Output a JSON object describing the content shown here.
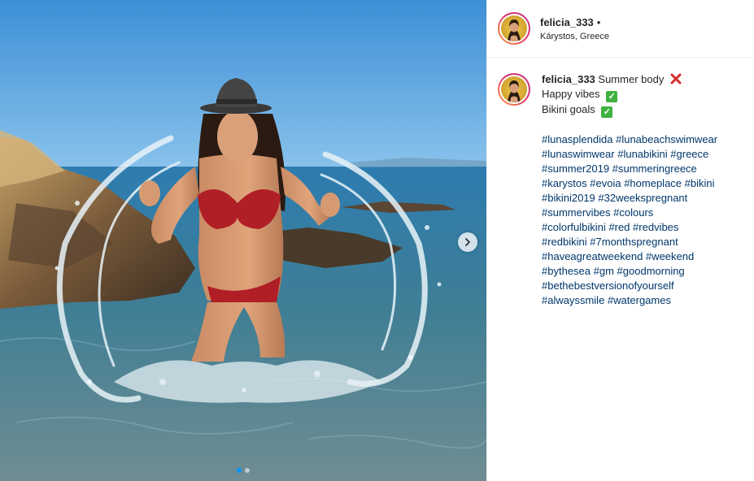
{
  "post": {
    "username": "felicia_333",
    "bullet": "•",
    "location": "Kárystos, Greece",
    "photo_description": "",
    "carousel": {
      "total": 2,
      "active": 1
    },
    "caption": {
      "username": "felicia_333",
      "line1": "Summer body",
      "line1_emoji": "cross-mark-icon",
      "line2": "Happy vibes",
      "line2_emoji": "check-mark-icon",
      "line3": "Bikini goals",
      "line3_emoji": "check-mark-icon"
    },
    "hashtag_lines": [
      [
        "#lunasplendida",
        "#lunabeachswimwear"
      ],
      [
        "#lunaswimwear",
        "#lunabikini",
        "#greece"
      ],
      [
        "#summer2019",
        "#summeringreece"
      ],
      [
        "#karystos",
        "#evoia",
        "#homeplace",
        "#bikini"
      ],
      [
        "#bikini2019",
        "#32weekspregnant"
      ],
      [
        "#summervibes",
        "#colours"
      ],
      [
        "#colorfulbikini",
        "#red",
        "#redvibes"
      ],
      [
        "#redbikini",
        "#7monthspregnant"
      ],
      [
        "#haveagreatweekend",
        "#weekend"
      ],
      [
        "#bythesea",
        "#gm",
        "#goodmorning"
      ],
      [
        "#bethebestversionofyourself"
      ],
      [
        "#alwayssmile",
        "#watergames"
      ]
    ]
  },
  "colors": {
    "link": "#00376b",
    "text": "#262626",
    "divider": "#efefef",
    "check_emoji": "#3fb13f",
    "cross_emoji": "#d62d2d"
  }
}
